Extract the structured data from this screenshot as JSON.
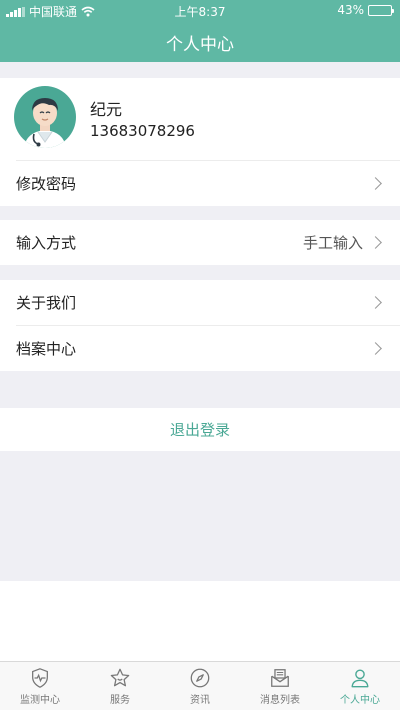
{
  "status_bar": {
    "carrier": "中国联通",
    "time": "上午8:37",
    "battery": "43%",
    "battery_fraction": 0.43
  },
  "header": {
    "title": "个人中心"
  },
  "profile": {
    "name": "纪元",
    "phone": "13683078296"
  },
  "menu": {
    "change_password": "修改密码",
    "input_method": {
      "label": "输入方式",
      "value": "手工输入"
    },
    "about_us": "关于我们",
    "archive_center": "档案中心"
  },
  "logout_label": "退出登录",
  "tabbar": {
    "items": [
      {
        "label": "监测中心",
        "icon": "shield-pulse-icon"
      },
      {
        "label": "服务",
        "icon": "star-icon"
      },
      {
        "label": "资讯",
        "icon": "compass-icon"
      },
      {
        "label": "消息列表",
        "icon": "envelope-icon"
      },
      {
        "label": "个人中心",
        "icon": "person-icon"
      }
    ],
    "active_color": "#4aa895"
  },
  "colors": {
    "header": "#5fb8a4",
    "accent": "#4aa895",
    "section_gap": "#efeff4"
  }
}
